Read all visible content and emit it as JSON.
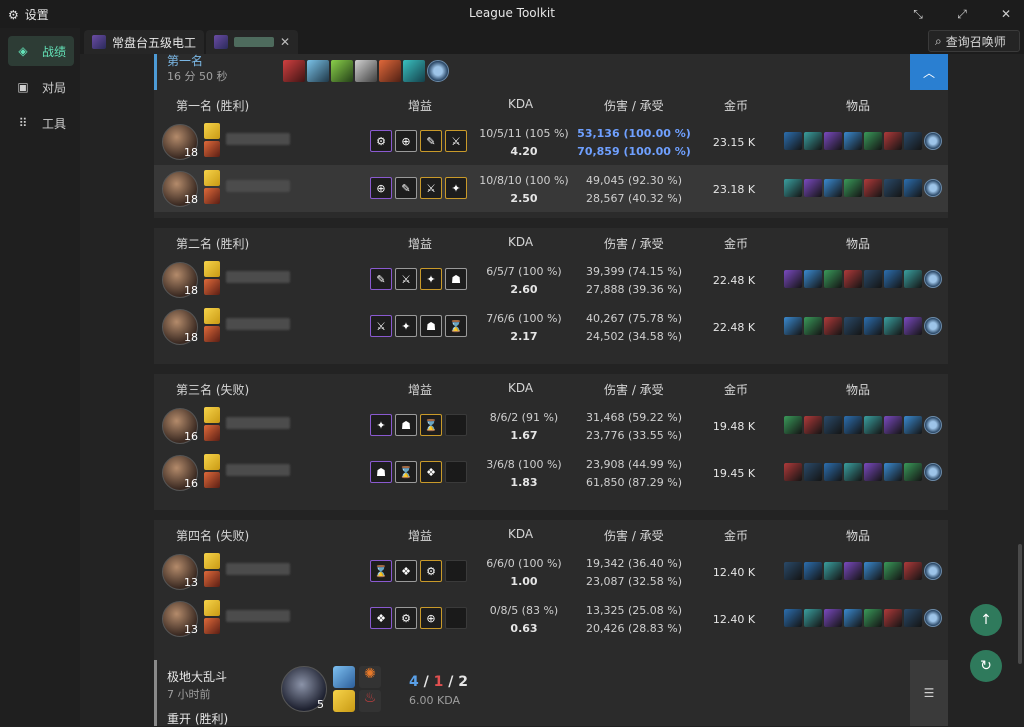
{
  "titlebar": {
    "settings_label": "设置",
    "title": "League Toolkit"
  },
  "sidebar": {
    "items": [
      {
        "label": "战绩"
      },
      {
        "label": "对局"
      },
      {
        "label": "工具"
      }
    ]
  },
  "tabs": [
    {
      "label": "常盘台五级电工"
    }
  ],
  "search": {
    "label": "查询召唤师"
  },
  "game_head": {
    "rank": "第一名",
    "duration": "16 分 50 秒"
  },
  "headers": {
    "augments": "增益",
    "kda": "KDA",
    "damage": "伤害 / 承受",
    "gold": "金币",
    "items": "物品"
  },
  "teams": [
    {
      "title": "第一名 (胜利)",
      "players": [
        {
          "level": "18",
          "kda": "10/5/11 (105 %)",
          "ratio": "4.20",
          "dmg": "53,136 (100.00 %)",
          "taken": "70,859 (100.00 %)",
          "gold": "23.15 K",
          "hi": true
        },
        {
          "level": "18",
          "kda": "10/8/10 (100 %)",
          "ratio": "2.50",
          "dmg": "49,045 (92.30 %)",
          "taken": "28,567 (40.32 %)",
          "gold": "23.18 K",
          "hi": false
        }
      ]
    },
    {
      "title": "第二名 (胜利)",
      "players": [
        {
          "level": "18",
          "kda": "6/5/7 (100 %)",
          "ratio": "2.60",
          "dmg": "39,399 (74.15 %)",
          "taken": "27,888 (39.36 %)",
          "gold": "22.48 K",
          "hi": false
        },
        {
          "level": "18",
          "kda": "7/6/6 (100 %)",
          "ratio": "2.17",
          "dmg": "40,267 (75.78 %)",
          "taken": "24,502 (34.58 %)",
          "gold": "22.48 K",
          "hi": false
        }
      ]
    },
    {
      "title": "第三名 (失败)",
      "players": [
        {
          "level": "16",
          "kda": "8/6/2 (91 %)",
          "ratio": "1.67",
          "dmg": "31,468 (59.22 %)",
          "taken": "23,776 (33.55 %)",
          "gold": "19.48 K",
          "hi": false
        },
        {
          "level": "16",
          "kda": "3/6/8 (100 %)",
          "ratio": "1.83",
          "dmg": "23,908 (44.99 %)",
          "taken": "61,850 (87.29 %)",
          "gold": "19.45 K",
          "hi": false
        }
      ]
    },
    {
      "title": "第四名 (失败)",
      "players": [
        {
          "level": "13",
          "kda": "6/6/0 (100 %)",
          "ratio": "1.00",
          "dmg": "19,342 (36.40 %)",
          "taken": "23,087 (32.58 %)",
          "gold": "12.40 K",
          "hi": false
        },
        {
          "level": "13",
          "kda": "0/8/5 (83 %)",
          "ratio": "0.63",
          "dmg": "13,325 (25.08 %)",
          "taken": "20,426 (28.83 %)",
          "gold": "12.40 K",
          "hi": false
        }
      ]
    }
  ],
  "bottom_game": {
    "mode": "极地大乱斗",
    "ago": "7 小时前",
    "result": "重开 (胜利)",
    "level": "5",
    "k": "4",
    "d": "1",
    "a": "2",
    "kda_ratio": "6.00 KDA"
  },
  "colors": {
    "accent_green": "#63e2b7",
    "blue_bar": "#2a7fd1",
    "fab_green": "#2f7a5c"
  },
  "icons": [
    "gear-icon",
    "layers-icon",
    "board-icon",
    "grid-icon",
    "search-icon",
    "close-icon",
    "minimize-icon",
    "maximize-icon",
    "chevron-up-icon",
    "list-icon",
    "arrow-up-icon",
    "refresh-icon"
  ]
}
